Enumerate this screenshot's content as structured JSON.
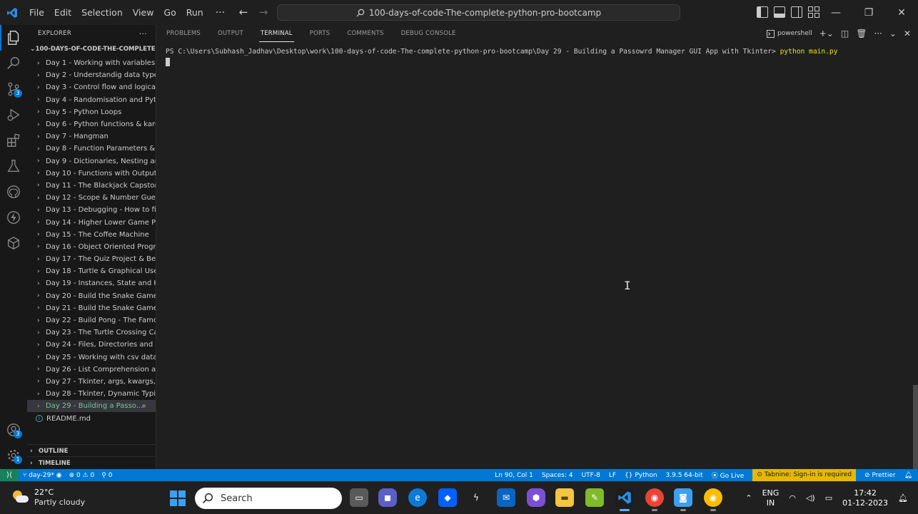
{
  "titlebar": {
    "menu": [
      "File",
      "Edit",
      "Selection",
      "View",
      "Go",
      "Run"
    ],
    "more": "···",
    "back": "←",
    "forward": "→",
    "command_center": "100-days-of-code-The-complete-python-pro-bootcamp"
  },
  "sidebar": {
    "title": "EXPLORER",
    "more": "···",
    "root": "100-DAYS-OF-CODE-THE-COMPLETE-...",
    "items": [
      "Day 1 - Working with variables i...",
      "Day 2 - Understandig data type...",
      "Day 3 - Control flow and logical ...",
      "Day 4 - Randomisation and Pyth...",
      "Day 5 - Python Loops",
      "Day 6 - Python functions & karel",
      "Day 7 - Hangman",
      "Day 8 - Function Parameters & ...",
      "Day 9 - Dictionaries, Nesting an...",
      "Day 10 - Functions with Outputs",
      "Day 11 - The Blackjack Capston...",
      "Day 12 - Scope & Number Gues...",
      "Day 13 - Debugging - How to fi...",
      "Day 14 - Higher Lower Game Pr...",
      "Day 15 - The Coffee Machine",
      "Day 16 - Object Oriented Progra...",
      "Day 17 - The Quiz Project & Ben...",
      "Day 18 - Turtle & Graphical Use...",
      "Day 19 - Instances, State and Hi...",
      "Day 20 - Build the Snake Game ...",
      "Day 21 - Build the Snake Game ...",
      "Day 22 - Build Pong - The Famo...",
      "Day 23 - The Turtle Crossing Ca...",
      "Day 24 - Files, Directories and P...",
      "Day 25 - Working with csv data ...",
      "Day 26 - List Comprehension an...",
      "Day 27 - Tkinter, args, kwargs, a...",
      "Day 28 - Tkinter, Dynamic Typin...",
      "Day 29 - Building a Passo..."
    ],
    "file": "README.md",
    "outline": "OUTLINE",
    "timeline": "TIMELINE",
    "badges": {
      "scm": "3",
      "accounts": "3",
      "settings": "1"
    }
  },
  "panel": {
    "tabs": [
      "PROBLEMS",
      "OUTPUT",
      "TERMINAL",
      "PORTS",
      "COMMENTS",
      "DEBUG CONSOLE"
    ],
    "active_tab": "TERMINAL",
    "shell": "powershell",
    "prompt": "PS C:\\Users\\Subhash_Jadhav\\Desktop\\work\\100-days-of-code-The-complete-python-pro-bootcamp\\Day 29 - Building a Passowrd Manager GUI App with Tkinter>",
    "command": "python main.py"
  },
  "statusbar": {
    "branch": "day-29*",
    "errors": "0",
    "warnings": "0",
    "ports": "0",
    "position": "Ln 90, Col 1",
    "spaces": "Spaces: 4",
    "encoding": "UTF-8",
    "eol": "LF",
    "language": "Python",
    "interpreter": "3.9.5 64-bit",
    "golive": "Go Live",
    "tabnine": "Tabnine: Sign-in is required",
    "prettier": "Prettier"
  },
  "taskbar": {
    "temp": "22°C",
    "weather": "Partly cloudy",
    "search": "Search",
    "lang1": "ENG",
    "lang2": "IN",
    "time": "17:42",
    "date": "01-12-2023"
  },
  "colors": {
    "accent": "#0078d4",
    "status_remote": "#16825d",
    "active_file": "#73c991",
    "tabnine": "#e6b800",
    "terminal_cmd": "#e5e510"
  }
}
